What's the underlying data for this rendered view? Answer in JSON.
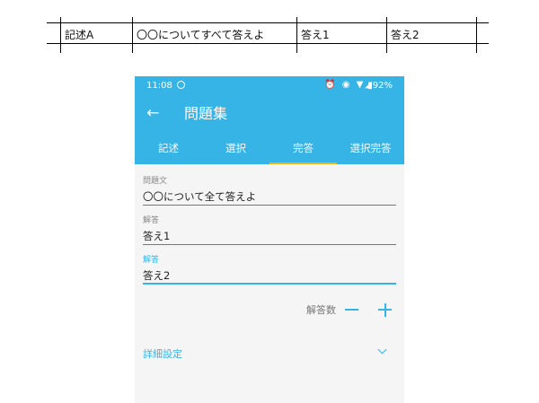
{
  "sheet": {
    "cells": [
      "記述A",
      "〇〇についてすべて答えよ",
      "答え1",
      "答え2"
    ]
  },
  "status_bar": {
    "time": "11:08",
    "icons": "⏰ ◉ ▼◢",
    "battery": "▮92%"
  },
  "toolbar": {
    "back_icon": "←",
    "title": "問題集"
  },
  "tabs": [
    {
      "label": "記述",
      "active": false
    },
    {
      "label": "選択",
      "active": false
    },
    {
      "label": "完答",
      "active": true
    },
    {
      "label": "選択完答",
      "active": false
    }
  ],
  "form": {
    "question": {
      "label": "問題文",
      "value": "〇〇について全て答えよ"
    },
    "answers": [
      {
        "label": "解答",
        "value": "答え1"
      },
      {
        "label": "解答",
        "value": "答え2"
      }
    ],
    "answer_count_label": "解答数",
    "details_label": "詳細設定"
  },
  "colors": {
    "accent": "#37b4e6",
    "tab_indicator": "#ffb300",
    "phone_background": "#f5f5f5"
  }
}
